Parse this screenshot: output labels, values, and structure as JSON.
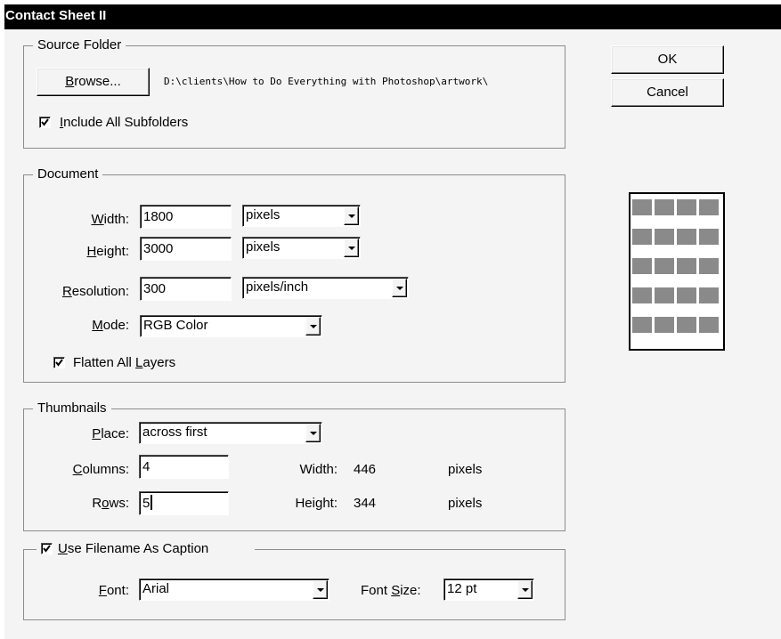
{
  "window": {
    "title": "Contact Sheet II"
  },
  "buttons": {
    "ok": "OK",
    "cancel": "Cancel"
  },
  "source_folder": {
    "legend": "Source Folder",
    "browse_prefix": "B",
    "browse_rest": "rowse...",
    "path": "D:\\clients\\How to Do Everything with Photoshop\\artwork\\",
    "include_subfolders_prefix": "I",
    "include_subfolders_rest": "nclude All Subfolders",
    "include_subfolders_checked": true
  },
  "document": {
    "legend": "Document",
    "width": {
      "label_u": "W",
      "label_rest": "idth:",
      "value": "1800",
      "unit": "pixels"
    },
    "height": {
      "label_u": "H",
      "label_rest": "eight:",
      "value": "3000",
      "unit": "pixels"
    },
    "resolution": {
      "label_u": "R",
      "label_rest": "esolution:",
      "value": "300",
      "unit": "pixels/inch"
    },
    "mode": {
      "label_u": "M",
      "label_rest": "ode:",
      "value": "RGB Color"
    },
    "flatten_pre": "Flatten All ",
    "flatten_u": "L",
    "flatten_rest": "ayers",
    "flatten_checked": true
  },
  "thumbnails": {
    "legend": "Thumbnails",
    "place": {
      "label_u": "P",
      "label_rest": "lace:",
      "value": "across first"
    },
    "columns": {
      "label_u": "C",
      "label_rest": "olumns:",
      "value": "4"
    },
    "rows": {
      "label_pre": "R",
      "label_u": "o",
      "label_rest": "ws:",
      "value": "5"
    },
    "width": {
      "label": "Width:",
      "value": "446",
      "unit": "pixels"
    },
    "height": {
      "label": "Height:",
      "value": "344",
      "unit": "pixels"
    }
  },
  "caption": {
    "checkbox_u": "U",
    "checkbox_rest": "se Filename As Caption",
    "checked": true,
    "font": {
      "label_u": "F",
      "label_rest": "ont:",
      "value": "Arial"
    },
    "font_size": {
      "label_pre": "Font ",
      "label_u": "S",
      "label_rest": "ize:",
      "value": "12 pt"
    }
  },
  "preview": {
    "columns": 4,
    "rows": 5
  }
}
